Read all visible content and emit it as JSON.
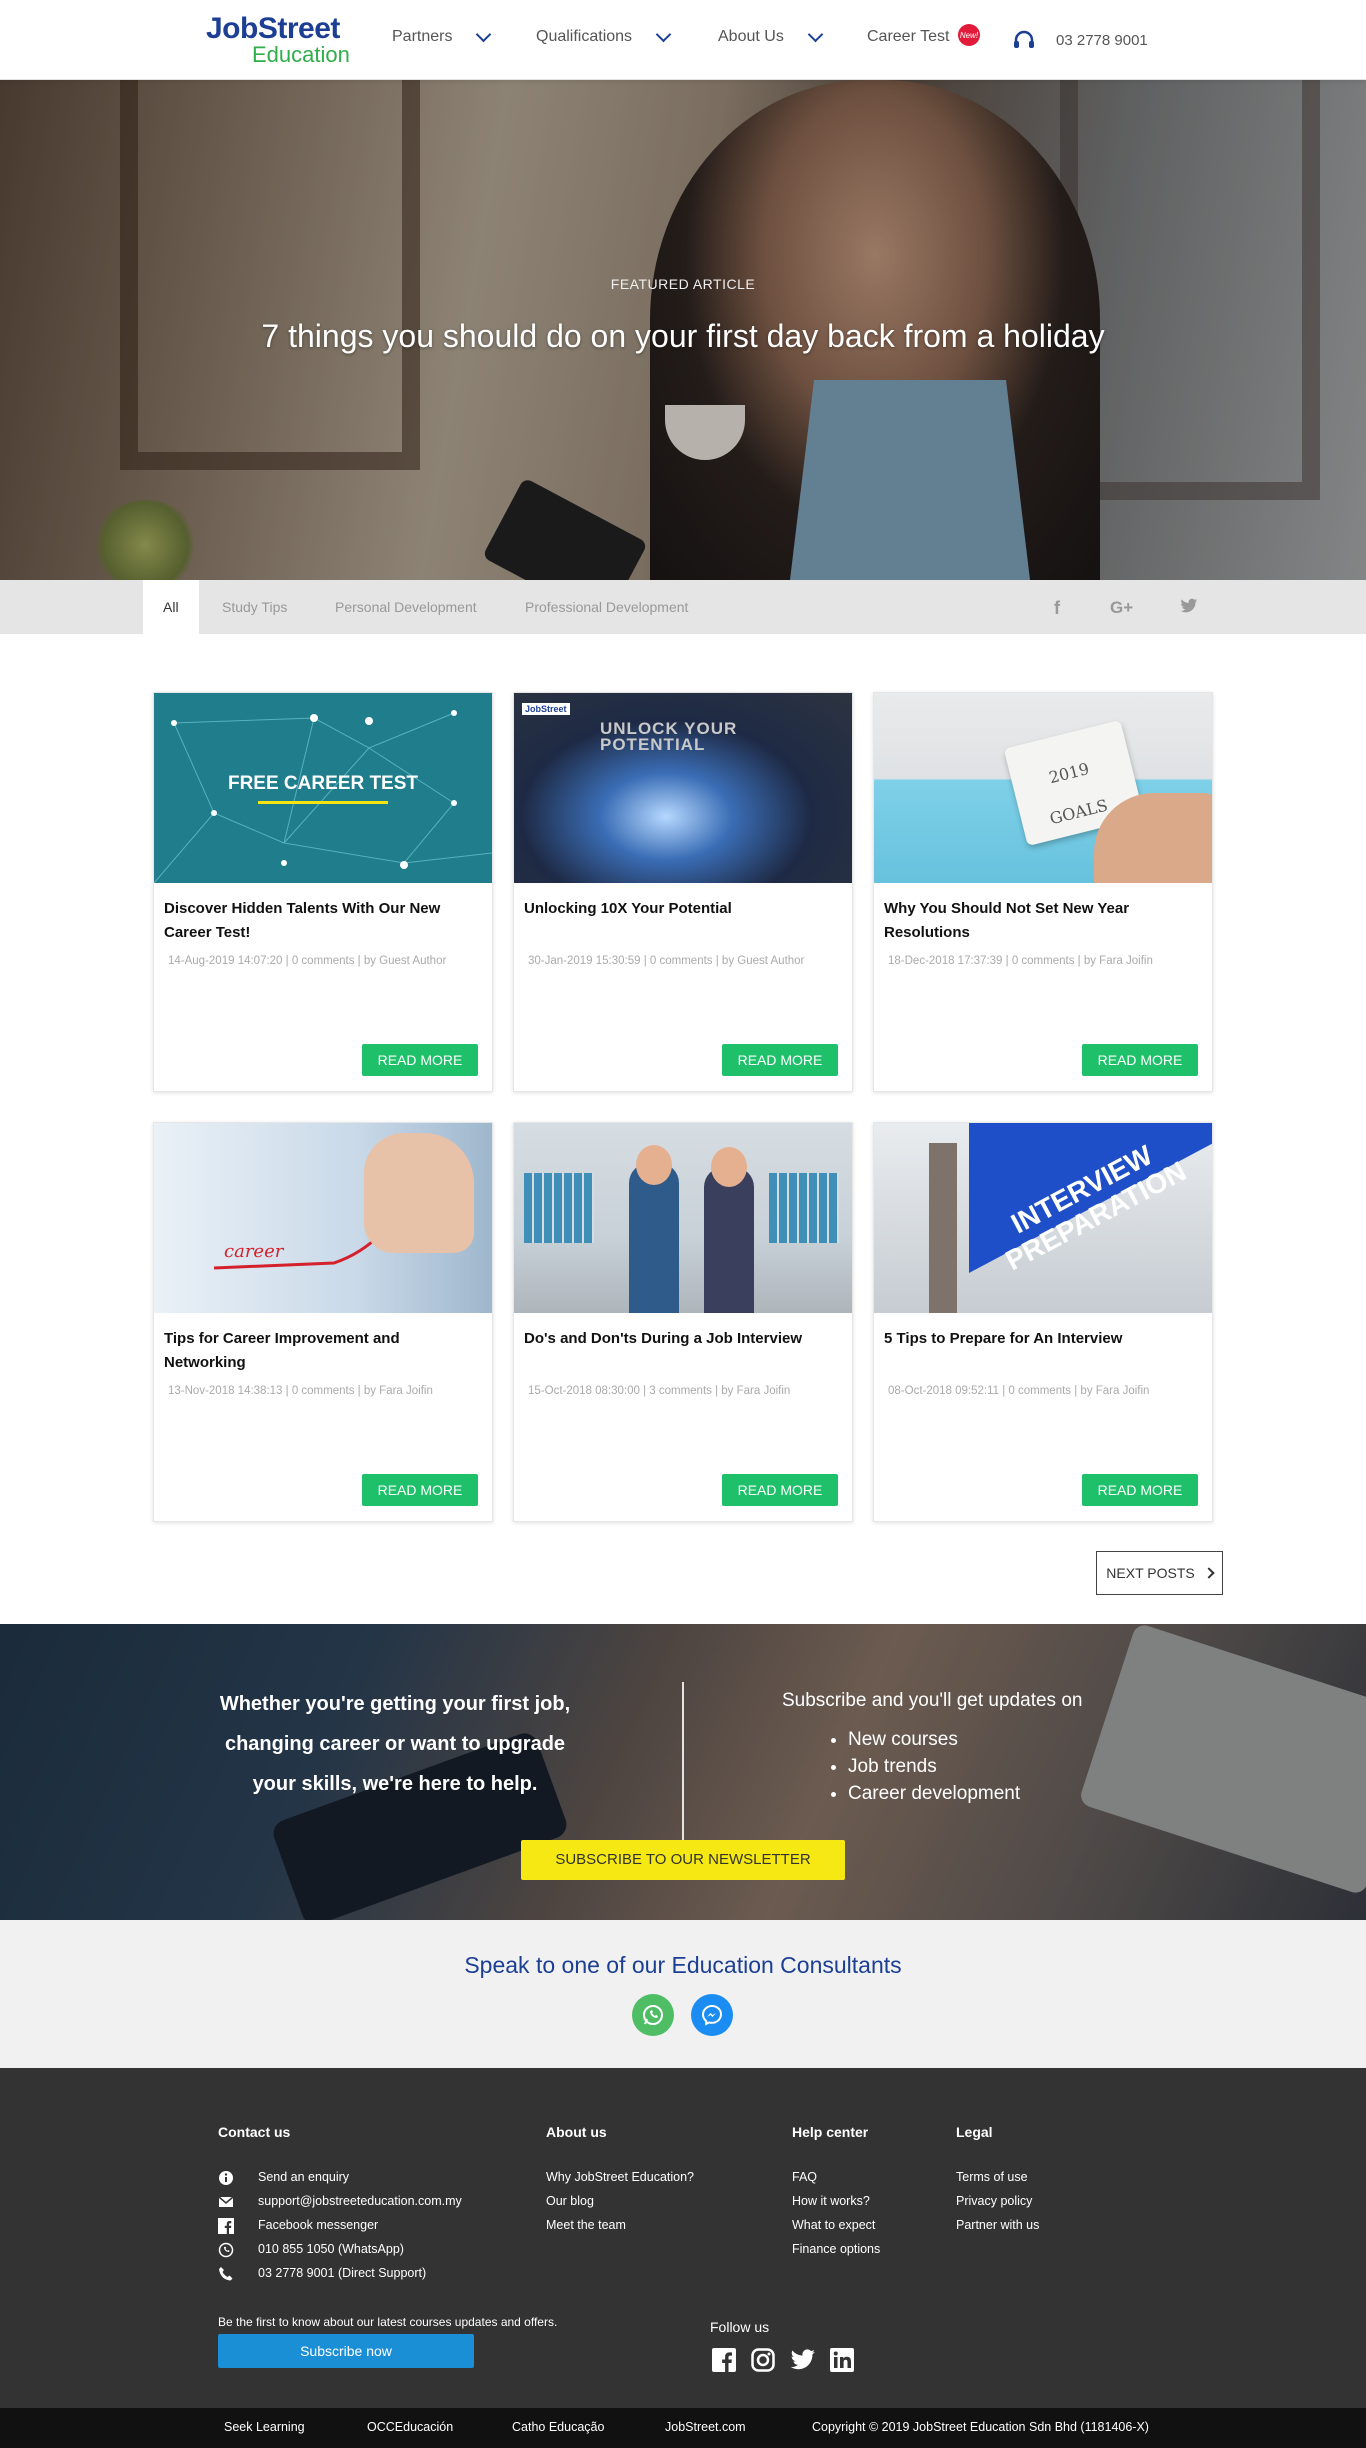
{
  "header": {
    "logo_top": "JobStreet",
    "logo_bottom": "Education",
    "nav": [
      "Partners",
      "Qualifications",
      "About Us",
      "Career Test"
    ],
    "new_badge": "New!",
    "phone": "03 2778 9001"
  },
  "hero": {
    "label": "FEATURED ARTICLE",
    "title": "7 things you should do on your first day back from a holiday"
  },
  "tabs": [
    "All",
    "Study Tips",
    "Personal Development",
    "Professional Development"
  ],
  "social_mini": [
    "f",
    "G+",
    "t"
  ],
  "cards": [
    {
      "image_text": "FREE CAREER TEST",
      "title": "Discover Hidden Talents With Our New Career Test!",
      "meta": "14-Aug-2019 14:07:20 | 0 comments | by Guest Author",
      "button": "READ MORE"
    },
    {
      "image_text": "UNLOCK YOUR POTENTIAL",
      "title": "Unlocking 10X Your Potential",
      "meta": "30-Jan-2019 15:30:59 | 0 comments | by Guest Author",
      "button": "READ MORE"
    },
    {
      "image_text": "2019 GOALS",
      "title": "Why You Should Not Set New Year Resolutions",
      "meta": "18-Dec-2018 17:37:39 | 0 comments | by Fara Joifin",
      "button": "READ MORE"
    },
    {
      "image_text": "career",
      "title": "Tips for Career Improvement and Networking",
      "meta": "13-Nov-2018 14:38:13 | 0 comments | by Fara Joifin",
      "button": "READ MORE"
    },
    {
      "image_text": "",
      "title": "Do's and Don'ts During a Job Interview",
      "meta": "15-Oct-2018 08:30:00 | 3 comments | by Fara Joifin",
      "button": "READ MORE"
    },
    {
      "image_text": "INTERVIEW PREPARATION",
      "title": "5 Tips to Prepare for An Interview",
      "meta": "08-Oct-2018 09:52:11 | 0 comments | by Fara Joifin",
      "button": "READ MORE"
    }
  ],
  "next_posts": "NEXT POSTS",
  "subscribe_band": {
    "left_text": "Whether you're getting your first job, changing career or want to upgrade your skills, we're here to help.",
    "right_title": "Subscribe and you'll get updates on",
    "items": [
      "New courses",
      "Job trends",
      "Career development"
    ],
    "button": "SUBSCRIBE TO OUR NEWSLETTER"
  },
  "consultants": {
    "title": "Speak to one of our Education Consultants"
  },
  "footer": {
    "contact": {
      "heading": "Contact us",
      "items": [
        "Send an enquiry",
        "support@jobstreeteducation.com.my",
        "Facebook messenger",
        "010 855 1050 (WhatsApp)",
        "03 2778 9001 (Direct Support)"
      ]
    },
    "about": {
      "heading": "About us",
      "items": [
        "Why JobStreet Education?",
        "Our blog",
        "Meet the team"
      ]
    },
    "help": {
      "heading": "Help center",
      "items": [
        "FAQ",
        "How it works?",
        "What to expect",
        "Finance options"
      ]
    },
    "legal": {
      "heading": "Legal",
      "items": [
        "Terms of use",
        "Privacy policy",
        "Partner with us"
      ]
    },
    "newsletter_text": "Be the first to know about our latest courses updates and offers.",
    "subscribe_button": "Subscribe now",
    "follow": "Follow us"
  },
  "bottom_links": [
    "Seek Learning",
    "OCCEducación",
    "Catho Educação",
    "JobStreet.com",
    "Copyright © 2019 JobStreet Education Sdn Bhd (1181406-X)"
  ],
  "colors": {
    "brand_blue": "#1c3f94",
    "brand_green": "#2fae49",
    "button_green": "#1ec169",
    "subscribe_yellow": "#f6e812",
    "footer_bg": "#333333"
  }
}
